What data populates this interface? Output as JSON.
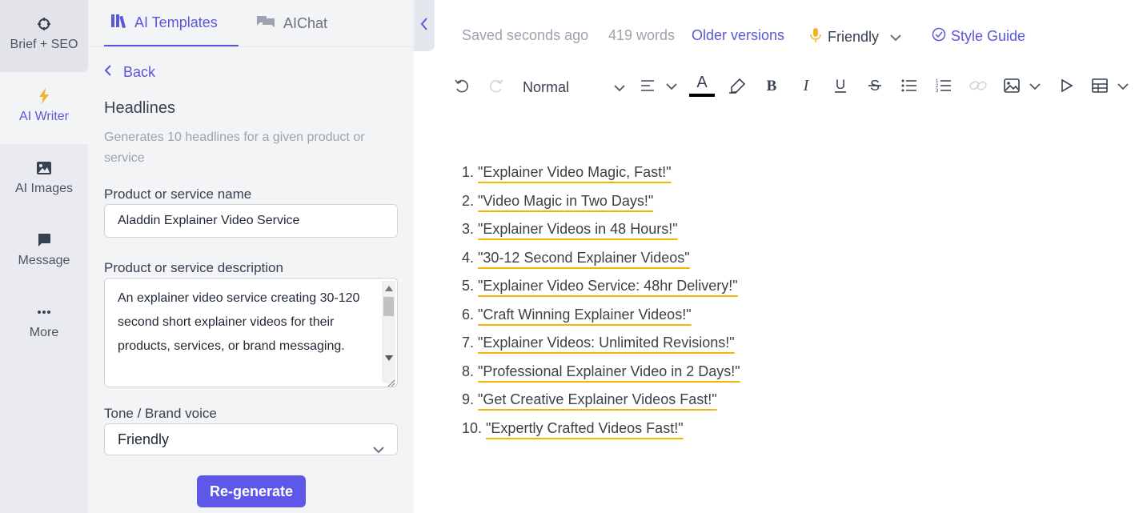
{
  "rail": {
    "items": [
      {
        "label": "Brief + SEO",
        "icon": "crosshair-icon"
      },
      {
        "label": "AI Writer",
        "icon": "lightning-icon"
      },
      {
        "label": "AI Images",
        "icon": "image-icon"
      },
      {
        "label": "Message",
        "icon": "chat-bubble-icon"
      },
      {
        "label": "More",
        "icon": "more-dots-icon"
      }
    ],
    "active_color": "#5b57d9"
  },
  "panel": {
    "tabs": [
      {
        "label": "AI Templates",
        "icon": "books-icon"
      },
      {
        "label": "AIChat",
        "icon": "chat-icon"
      }
    ],
    "back_label": "Back",
    "template_title": "Headlines",
    "template_desc": "Generates 10 headlines for a given product or service",
    "fields": {
      "name_label": "Product or service name",
      "name_value": "Aladdin Explainer Video Service",
      "desc_label": "Product or service description",
      "desc_value": "An explainer video service creating 30-120 second short explainer videos for their products, services, or brand messaging.",
      "tone_label": "Tone / Brand voice",
      "tone_value": "Friendly"
    },
    "regenerate_label": "Re-generate",
    "button_color": "#5e58e8"
  },
  "editor": {
    "status": {
      "saved": "Saved seconds ago",
      "words": "419 words",
      "older_versions": "Older versions",
      "voice": "Friendly",
      "style_guide": "Style Guide"
    },
    "toolbar": {
      "format": "Normal"
    },
    "headlines": [
      {
        "num": "1.",
        "text": "\"Explainer Video Magic, Fast!\""
      },
      {
        "num": "2.",
        "text": "\"Video Magic in Two Days!\""
      },
      {
        "num": "3.",
        "text": "\"Explainer Videos in 48 Hours!\""
      },
      {
        "num": "4.",
        "text": "\"30-12 Second Explainer Videos\""
      },
      {
        "num": "5.",
        "text": "\"Explainer Video Service: 48hr Delivery!\""
      },
      {
        "num": "6.",
        "text": "\"Craft Winning Explainer Videos!\""
      },
      {
        "num": "7.",
        "text": "\"Explainer Videos: Unlimited Revisions!\""
      },
      {
        "num": "8.",
        "text": "\"Professional Explainer Video in 2 Days!\""
      },
      {
        "num": "9.",
        "text": "\"Get Creative Explainer Videos Fast!\""
      },
      {
        "num": "10.",
        "text": "\"Expertly Crafted Videos Fast!\""
      }
    ],
    "spellcheck_underline_color": "#f5b400"
  }
}
